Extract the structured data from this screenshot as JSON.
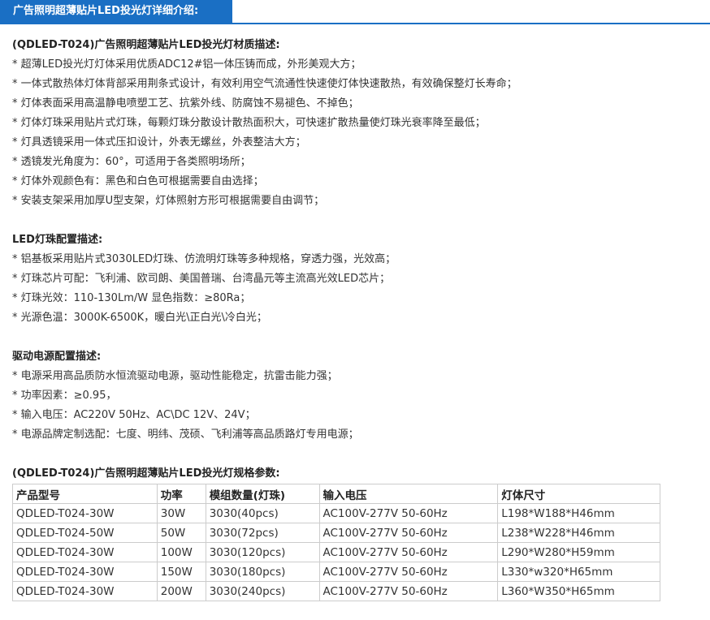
{
  "header": {
    "tab_label": "广告照明超薄贴片LED投光灯详细介绍:"
  },
  "sections": [
    {
      "title": "(QDLED-T024)广告照明超薄贴片LED投光灯材质描述:",
      "lines": [
        "* 超薄LED投光灯灯体采用优质ADC12#铝一体压铸而成，外形美观大方；",
        "* 一体式散热体灯体背部采用荆条式设计，有效利用空气流通性快速使灯体快速散热，有效确保整灯长寿命；",
        "* 灯体表面采用高温静电喷塑工艺、抗紫外线、防腐蚀不易褪色、不掉色；",
        "* 灯体灯珠采用贴片式灯珠，每颗灯珠分散设计散热面积大，可快速扩散热量使灯珠光衰率降至最低；",
        "* 灯具透镜采用一体式压扣设计，外表无螺丝，外表整洁大方；",
        "* 透镜发光角度为：60°，可适用于各类照明场所；",
        "* 灯体外观颜色有：黑色和白色可根据需要自由选择；",
        "* 安装支架采用加厚U型支架，灯体照射方形可根据需要自由调节；"
      ]
    },
    {
      "title": "LED灯珠配置描述:",
      "lines": [
        "* 铝基板采用贴片式3030LED灯珠、仿流明灯珠等多种规格，穿透力强，光效高；",
        "* 灯珠芯片可配：飞利浦、欧司朗、美国普瑞、台湾晶元等主流高光效LED芯片；",
        "* 灯珠光效：110-130Lm/W 显色指数：≥80Ra；",
        "* 光源色温：3000K-6500K，暖白光\\正白光\\冷白光；"
      ]
    },
    {
      "title": "驱动电源配置描述:",
      "lines": [
        "* 电源采用高品质防水恒流驱动电源，驱动性能稳定，抗雷击能力强；",
        "* 功率因素：≥0.95，",
        "* 输入电压：AC220V 50Hz、AC\\DC 12V、24V；",
        "* 电源品牌定制选配：七度、明纬、茂硕、飞利浦等高品质路灯专用电源；"
      ]
    }
  ],
  "spec_table": {
    "title": "(QDLED-T024)广告照明超薄贴片LED投光灯规格参数:",
    "headers": [
      "产品型号",
      "功率",
      "模组数量(灯珠)",
      "输入电压",
      "灯体尺寸"
    ],
    "rows": [
      [
        "QDLED-T024-30W",
        "30W",
        "3030(40pcs)",
        "AC100V-277V 50-60Hz",
        "L198*W188*H46mm"
      ],
      [
        "QDLED-T024-50W",
        "50W",
        "3030(72pcs)",
        "AC100V-277V 50-60Hz",
        "L238*W228*H46mm"
      ],
      [
        "QDLED-T024-30W",
        "100W",
        "3030(120pcs)",
        "AC100V-277V 50-60Hz",
        "L290*W280*H59mm"
      ],
      [
        "QDLED-T024-30W",
        "150W",
        "3030(180pcs)",
        "AC100V-277V 50-60Hz",
        "L330*w320*H65mm"
      ],
      [
        "QDLED-T024-30W",
        "200W",
        "3030(240pcs)",
        "AC100V-277V 50-60Hz",
        "L360*W350*H65mm"
      ]
    ]
  },
  "colors": {
    "accent": "#1a6fc4",
    "text": "#333333",
    "table_border": "#cccccc"
  }
}
